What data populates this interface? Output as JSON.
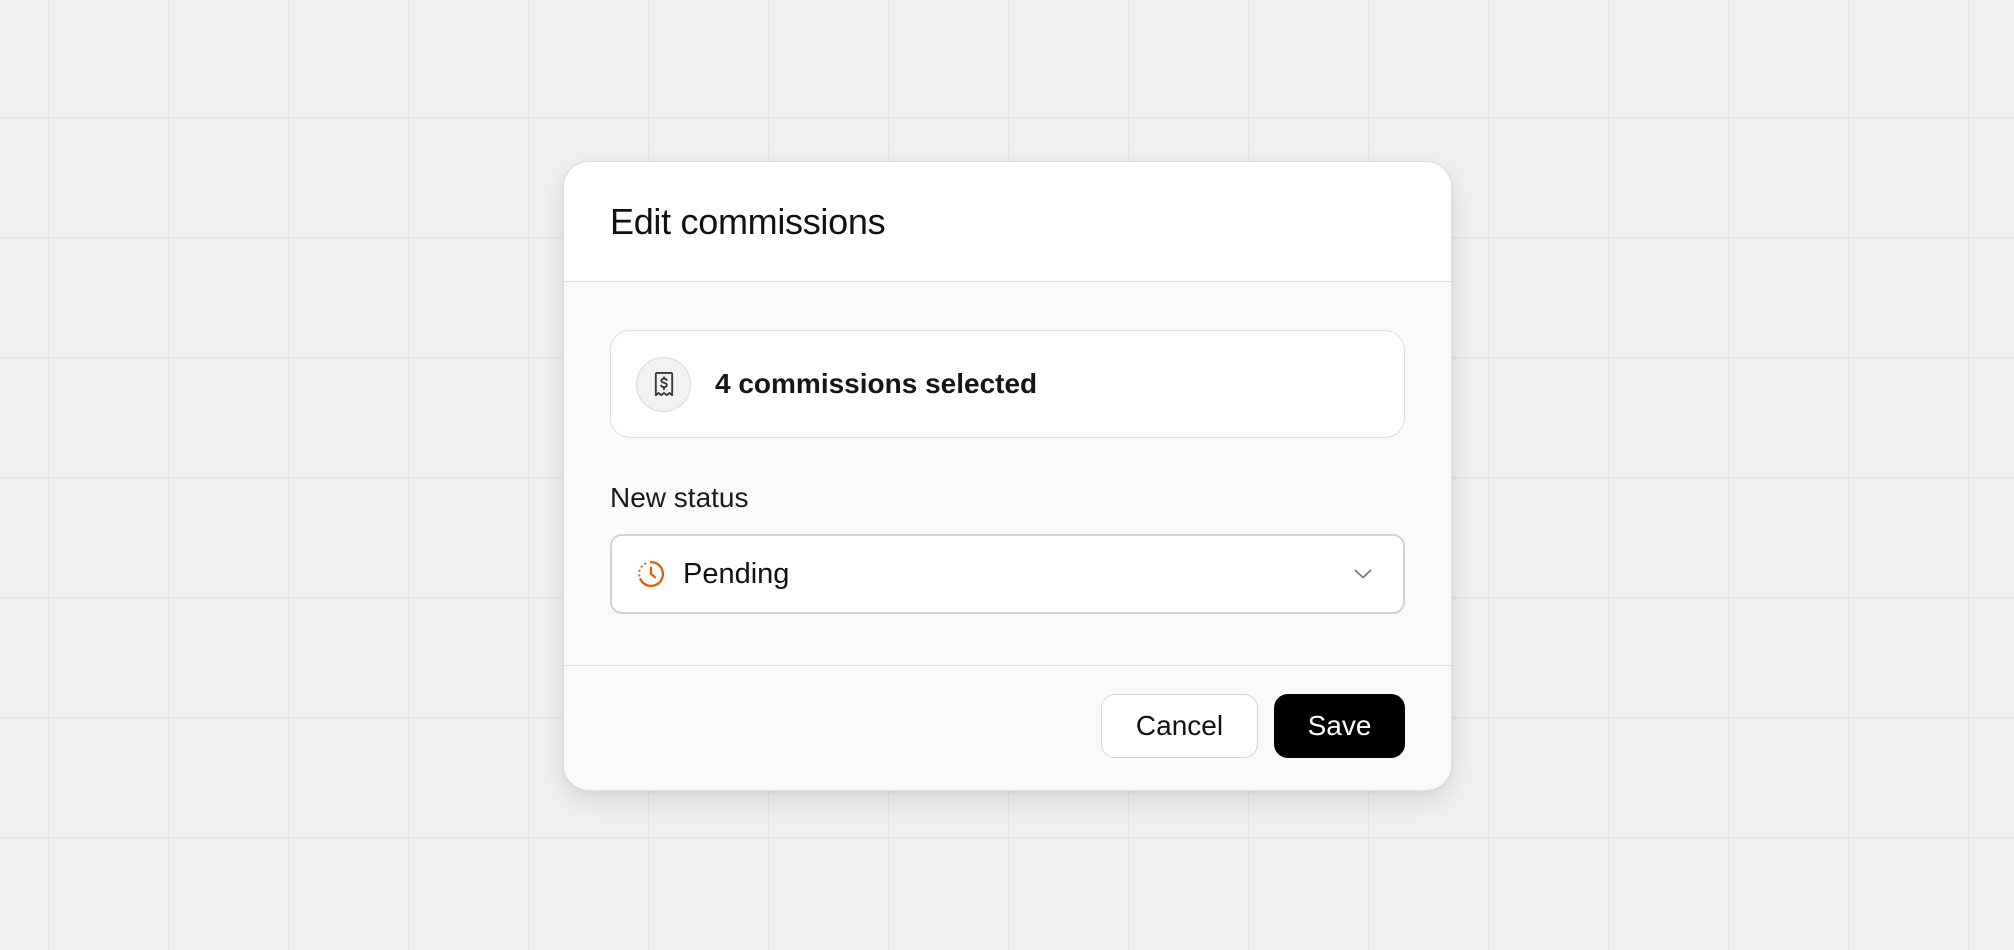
{
  "modal": {
    "title": "Edit commissions"
  },
  "selection": {
    "text": "4 commissions selected",
    "icon": "receipt-dollar-icon"
  },
  "status_field": {
    "label": "New status",
    "value": "Pending",
    "icon": "clock-dashed-icon",
    "icon_color": "#e8590c"
  },
  "footer": {
    "cancel_label": "Cancel",
    "save_label": "Save"
  },
  "colors": {
    "primary_button": "#000000",
    "pending_accent": "#e8590c"
  }
}
